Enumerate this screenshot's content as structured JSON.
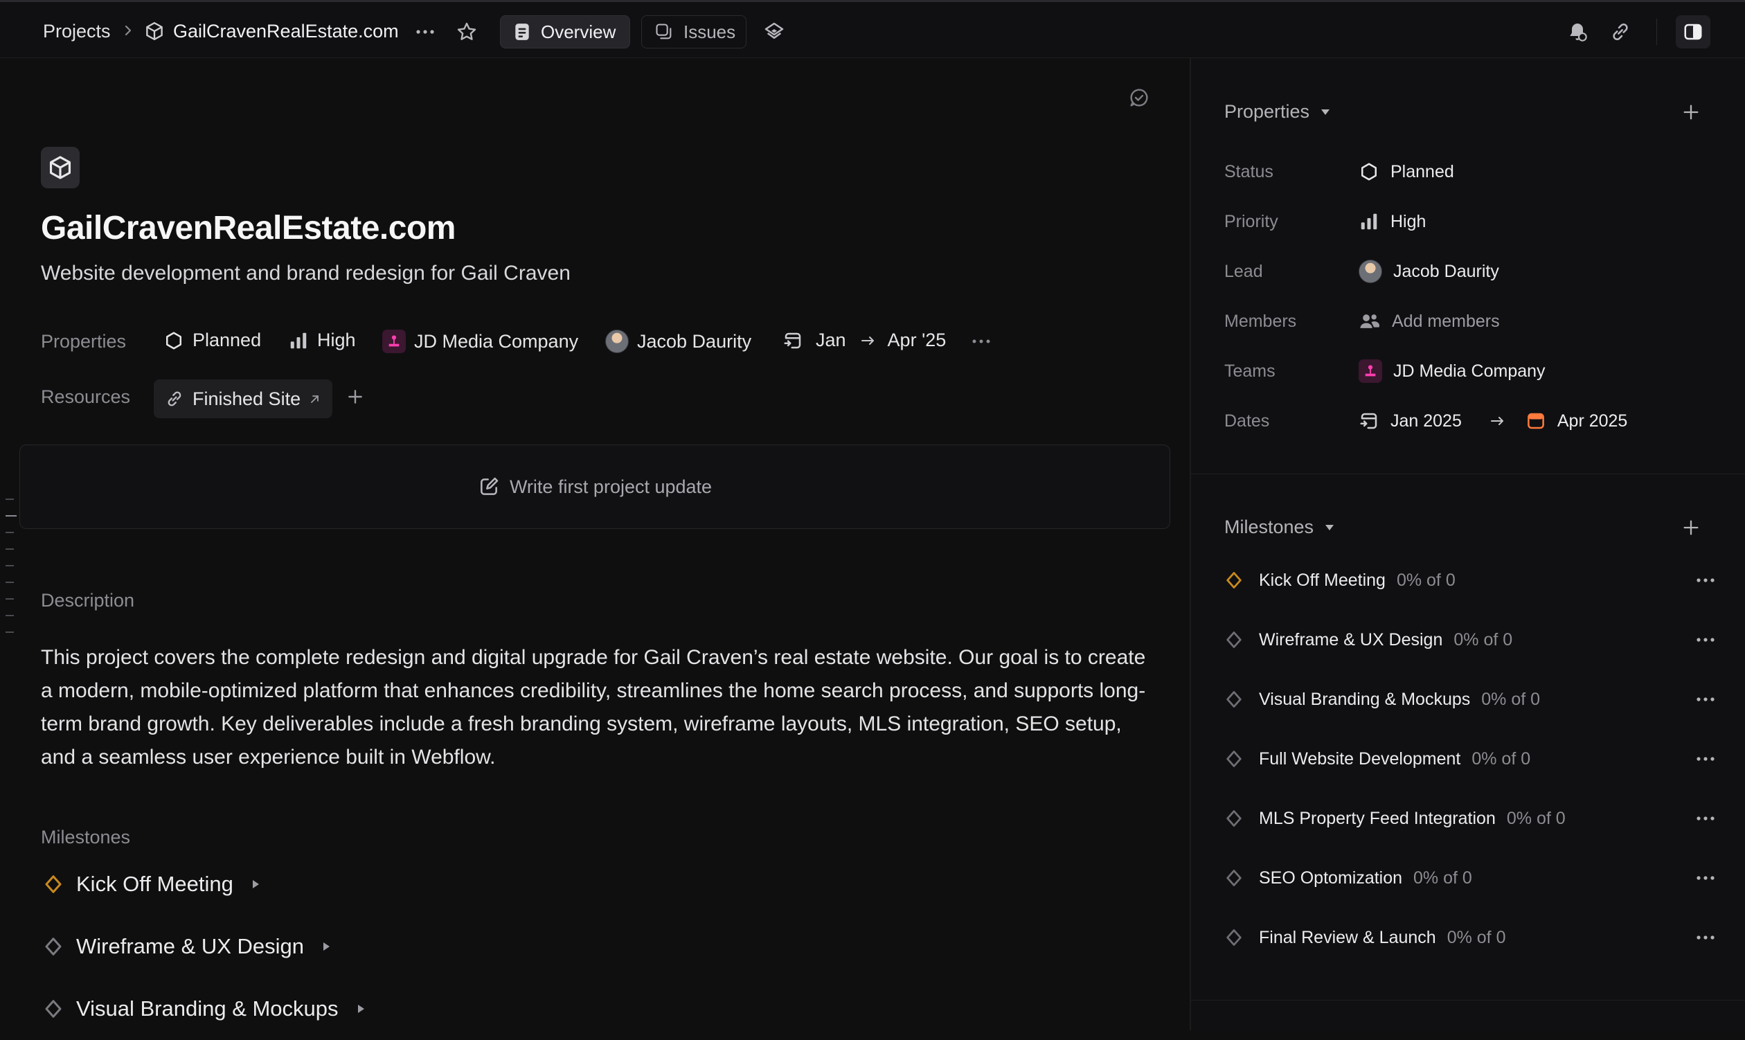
{
  "topbar": {
    "breadcrumb_projects": "Projects",
    "breadcrumb_project": "GailCravenRealEstate.com",
    "tab_overview": "Overview",
    "tab_issues": "Issues"
  },
  "project": {
    "title": "GailCravenRealEstate.com",
    "subtitle": "Website development and brand redesign for Gail Craven",
    "properties_label": "Properties",
    "status": "Planned",
    "priority": "High",
    "team": "JD Media Company",
    "lead": "Jacob Daurity",
    "date_start": "Jan",
    "date_end": "Apr '25",
    "resources_label": "Resources",
    "resource_link": "Finished Site",
    "update_prompt": "Write first project update",
    "description_label": "Description",
    "description": "This project covers the complete redesign and digital upgrade for Gail Craven’s real estate website. Our goal is to create a modern, mobile-optimized platform that enhances credibility, streamlines the home search process, and supports long-term brand growth. Key deliverables include a fresh branding system, wireframe layouts, MLS integration, SEO setup, and a seamless user experience built in Webflow.",
    "milestones_label": "Milestones",
    "milestones": [
      "Kick Off Meeting",
      "Wireframe & UX Design",
      "Visual Branding & Mockups"
    ]
  },
  "sidepanel": {
    "properties_header": "Properties",
    "rows": {
      "status_label": "Status",
      "status_value": "Planned",
      "priority_label": "Priority",
      "priority_value": "High",
      "lead_label": "Lead",
      "lead_value": "Jacob Daurity",
      "members_label": "Members",
      "members_value": "Add members",
      "teams_label": "Teams",
      "teams_value": "JD Media Company",
      "dates_label": "Dates",
      "date_start": "Jan 2025",
      "date_end": "Apr 2025"
    },
    "milestones_header": "Milestones",
    "milestones": [
      {
        "name": "Kick Off Meeting",
        "progress": "0% of 0"
      },
      {
        "name": "Wireframe & UX Design",
        "progress": "0% of 0"
      },
      {
        "name": "Visual Branding & Mockups",
        "progress": "0% of 0"
      },
      {
        "name": "Full Website Development",
        "progress": "0% of 0"
      },
      {
        "name": "MLS Property Feed Integration",
        "progress": "0% of 0"
      },
      {
        "name": "SEO Optomization",
        "progress": "0% of 0"
      },
      {
        "name": "Final Review & Launch",
        "progress": "0% of 0"
      }
    ]
  },
  "colors": {
    "accent_milestone": "#c98a1e",
    "team_pink": "#ff3fb0",
    "date_end_orange": "#ff7a3d"
  }
}
